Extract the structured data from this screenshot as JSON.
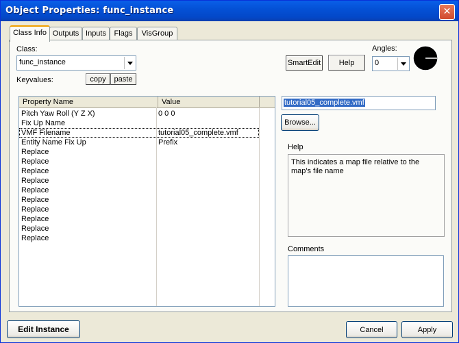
{
  "window": {
    "title": "Object Properties: func_instance",
    "close_glyph": "✕"
  },
  "tabs": [
    {
      "label": "Class Info",
      "active": true
    },
    {
      "label": "Outputs"
    },
    {
      "label": "Inputs"
    },
    {
      "label": "Flags"
    },
    {
      "label": "VisGroup"
    }
  ],
  "class_section": {
    "label": "Class:",
    "value": "func_instance",
    "keyvalues_label": "Keyvalues:",
    "copy_label": "copy",
    "paste_label": "paste"
  },
  "top_right": {
    "smartedit_label": "SmartEdit",
    "help_label": "Help",
    "angles_label": "Angles:",
    "angles_value": "0"
  },
  "grid": {
    "headers": [
      "Property Name",
      "Value"
    ],
    "rows": [
      {
        "name": "Pitch Yaw Roll (Y Z X)",
        "value": "0 0 0"
      },
      {
        "name": "Fix Up Name",
        "value": ""
      },
      {
        "name": "VMF Filename",
        "value": "tutorial05_complete.vmf",
        "selected": true
      },
      {
        "name": "Entity Name Fix Up",
        "value": "Prefix"
      },
      {
        "name": "Replace",
        "value": ""
      },
      {
        "name": "Replace",
        "value": ""
      },
      {
        "name": "Replace",
        "value": ""
      },
      {
        "name": "Replace",
        "value": ""
      },
      {
        "name": "Replace",
        "value": ""
      },
      {
        "name": "Replace",
        "value": ""
      },
      {
        "name": "Replace",
        "value": ""
      },
      {
        "name": "Replace",
        "value": ""
      },
      {
        "name": "Replace",
        "value": ""
      },
      {
        "name": "Replace",
        "value": ""
      }
    ]
  },
  "value_editor": {
    "value": "tutorial05_complete.vmf",
    "browse_label": "Browse...",
    "help_label": "Help",
    "help_text": "This indicates a map file relative to the map's file name",
    "comments_label": "Comments",
    "comments_value": ""
  },
  "footer": {
    "edit_instance_label": "Edit Instance",
    "cancel_label": "Cancel",
    "apply_label": "Apply"
  },
  "colors": {
    "title_bar": "#0451d6",
    "selection": "#316ac5",
    "active_tab_accent": "#f0a000"
  }
}
